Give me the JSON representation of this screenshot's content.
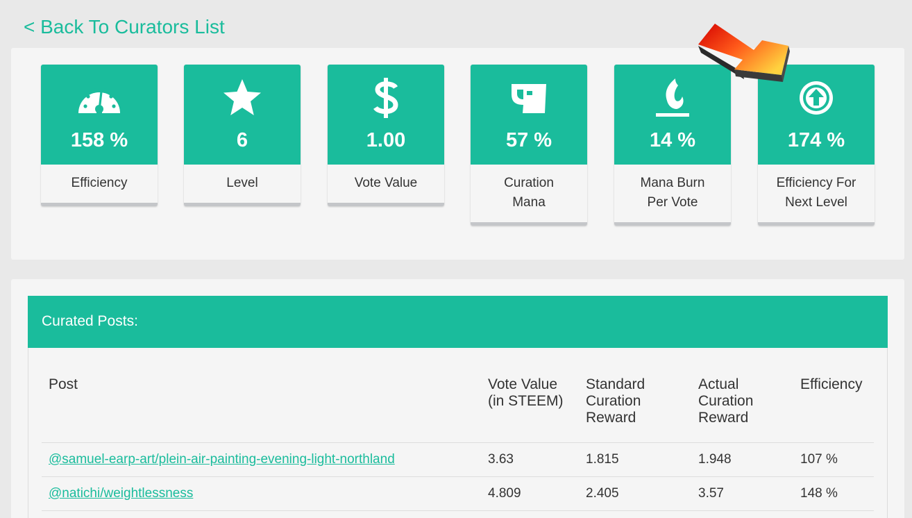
{
  "nav": {
    "back_label": "< Back To Curators List"
  },
  "stats": [
    {
      "icon": "speedometer-icon",
      "value": "158 %",
      "label": "Efficiency"
    },
    {
      "icon": "star-icon",
      "value": "6",
      "label": "Level"
    },
    {
      "icon": "dollar-icon",
      "value": "1.00",
      "label": "Vote Value"
    },
    {
      "icon": "cup-icon",
      "value": "57 %",
      "label_line1": "Curation",
      "label_line2": "Mana"
    },
    {
      "icon": "flame-icon",
      "value": "14 %",
      "label_line1": "Mana Burn",
      "label_line2": "Per Vote"
    },
    {
      "icon": "circle-arrow-up-icon",
      "value": "174 %",
      "label_line1": "Efficiency For",
      "label_line2": "Next Level"
    }
  ],
  "posts": {
    "title": "Curated Posts:",
    "columns": {
      "post": "Post",
      "vote_value_1": "Vote Value",
      "vote_value_2": "(in STEEM)",
      "standard_1": "Standard",
      "standard_2": "Curation",
      "standard_3": "Reward",
      "actual_1": "Actual",
      "actual_2": "Curation",
      "actual_3": "Reward",
      "efficiency": "Efficiency"
    },
    "rows": [
      {
        "post": "@samuel-earp-art/plein-air-painting-evening-light-northland",
        "vote_value": "3.63",
        "standard": "1.815",
        "actual": "1.948",
        "efficiency": "107 %"
      },
      {
        "post": "@natichi/weightlessness",
        "vote_value": "4.809",
        "standard": "2.405",
        "actual": "3.57",
        "efficiency": "148 %"
      }
    ]
  },
  "colors": {
    "accent": "#1abc9c",
    "background": "#e9e9e9",
    "panel": "#f5f5f5",
    "arrow_start": "#e00000",
    "arrow_end": "#ffd23f"
  }
}
